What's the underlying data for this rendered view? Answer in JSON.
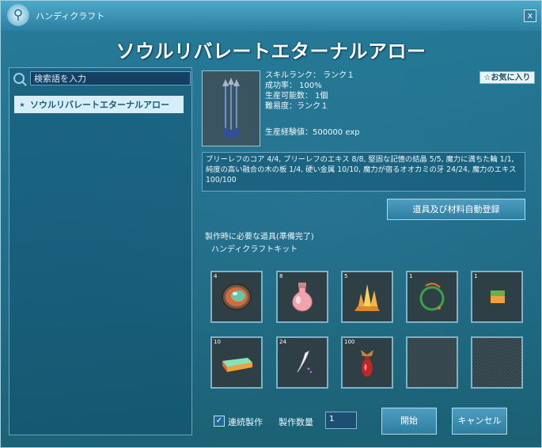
{
  "window": {
    "title": "ハンディクラフト",
    "close_label": "x"
  },
  "recipe": {
    "name": "ソウルリバレートエターナルアロー",
    "stats": [
      "スキルランク： ランク１",
      "成功率： 100%",
      "生産可能数： 1個",
      "難易度：ランク１"
    ],
    "exp": "生産経験値：500000 exp",
    "favorite_label": "☆お気に入り",
    "materials_text": "ブリーレフのコア 4/4, ブリーレフのエキス 8/8, 堅固な記憶の結晶 5/5, 魔力に満ちた輪 1/1, 純度の高い融合の木の板 1/4, 硬い金属 10/10, 魔力が宿るオオカミの牙 24/24, 魔力のエキス 100/100"
  },
  "search": {
    "placeholder": "検索語を入力"
  },
  "recipe_list": [
    {
      "bullet": "★",
      "label": "ソウルリバレートエターナルアロー"
    }
  ],
  "auto_register_label": "道具及び材料自動登録",
  "tools": {
    "title": "製作時に必要な道具(準備完了)",
    "items": [
      "ハンディクラフトキット"
    ]
  },
  "ingredient_slots": [
    {
      "qty": "4",
      "icon": "gem-core-icon"
    },
    {
      "qty": "8",
      "icon": "potion-bottle-icon"
    },
    {
      "qty": "5",
      "icon": "crystal-cluster-icon"
    },
    {
      "qty": "1",
      "icon": "magic-ring-icon"
    },
    {
      "qty": "1",
      "icon": "wood-board-icon"
    },
    {
      "qty": "10",
      "icon": "metal-ingot-icon"
    },
    {
      "qty": "24",
      "icon": "wolf-fang-icon"
    },
    {
      "qty": "100",
      "icon": "essence-vial-icon"
    },
    {
      "qty": "",
      "icon": "empty-slot"
    },
    {
      "qty": "",
      "icon": "empty-slot"
    }
  ],
  "footer": {
    "continuous_label": "連続製作",
    "quantity_label": "製作数量",
    "quantity_value": "1",
    "start_label": "開始",
    "cancel_label": "キャンセル"
  },
  "colors": {
    "accent": "#2b7fa2",
    "panel": "#1f7a9c",
    "highlight": "#d5eef7"
  }
}
